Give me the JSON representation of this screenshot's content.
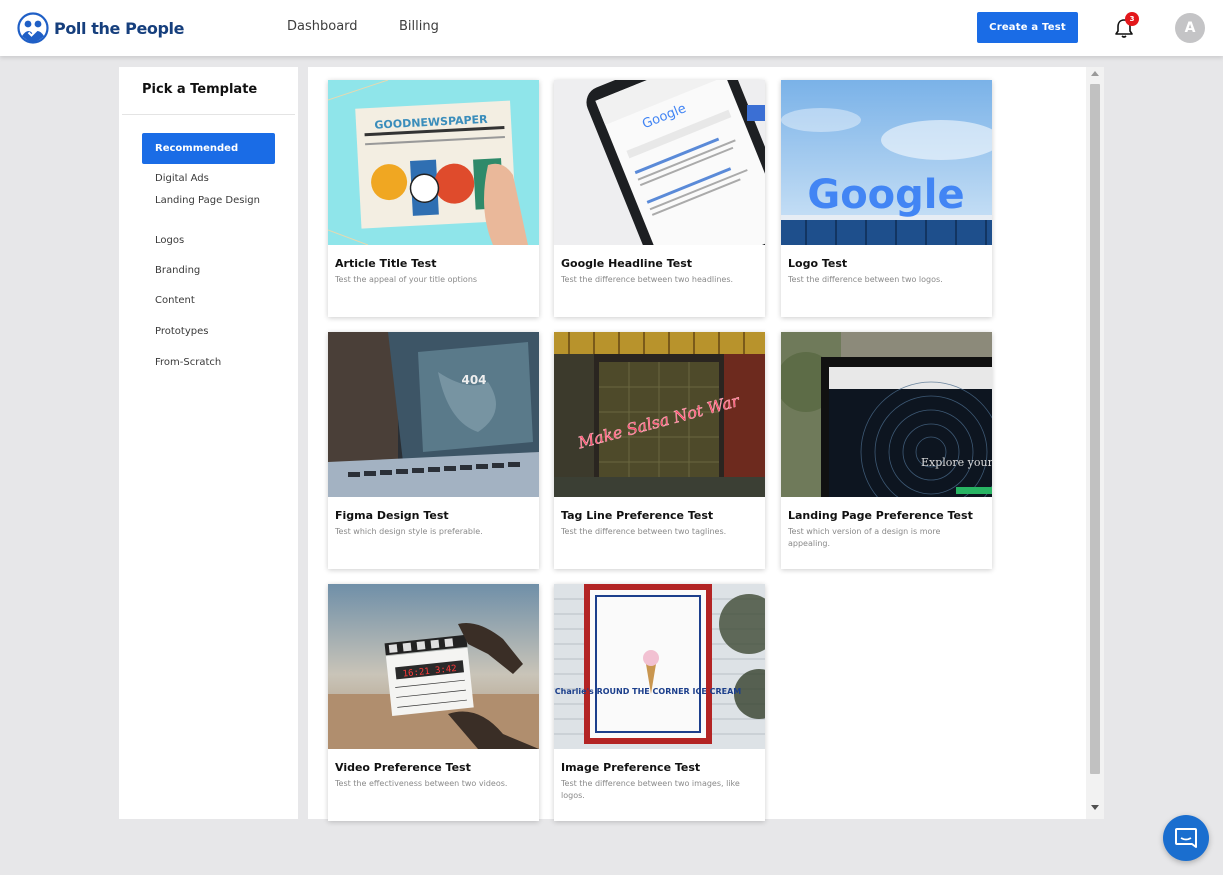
{
  "header": {
    "brand": "Poll the People",
    "nav": [
      "Dashboard",
      "Billing"
    ],
    "create_label": "Create a Test",
    "notification_count": "3",
    "avatar_initial": "A"
  },
  "sidebar": {
    "title": "Pick a Template",
    "selected": "Recommended",
    "categories": [
      "Digital Ads",
      "Landing Page Design",
      "Logos",
      "Branding",
      "Content",
      "Prototypes",
      "From-Scratch"
    ]
  },
  "templates": [
    {
      "title": "Article Title Test",
      "desc": "Test the appeal of your title options",
      "image": "newspaper-photo",
      "image_text": "GOODNEWSPAPER"
    },
    {
      "title": "Google Headline Test",
      "desc": "Test the difference between two headlines.",
      "image": "phone-google-search-photo",
      "image_text": "Google"
    },
    {
      "title": "Logo Test",
      "desc": "Test the difference between two logos.",
      "image": "google-sign-photo",
      "image_text": "Google"
    },
    {
      "title": "Figma Design Test",
      "desc": "Test which design style is preferable.",
      "image": "laptop-404-photo",
      "image_text": "404"
    },
    {
      "title": "Tag Line Preference Test",
      "desc": "Test the difference between two taglines.",
      "image": "neon-sign-photo",
      "image_text": "Make Salsa Not War"
    },
    {
      "title": "Landing Page Preference Test",
      "desc": "Test which version of a design is more appealing.",
      "image": "laptop-landing-page-photo",
      "image_text": "Explore your c"
    },
    {
      "title": "Video Preference Test",
      "desc": "Test the effectiveness between two videos.",
      "image": "clapperboard-photo",
      "image_text": "16:21 3:42"
    },
    {
      "title": "Image Preference Test",
      "desc": "Test the difference between two images, like logos.",
      "image": "charlies-sign-photo",
      "image_text": "Charlie's ROUND THE CORNER ICE CREAM"
    }
  ],
  "colors": {
    "accent": "#1a6ce6",
    "brand_text": "#163f7d",
    "badge": "#e3171b",
    "background": "#e7e7e9"
  }
}
